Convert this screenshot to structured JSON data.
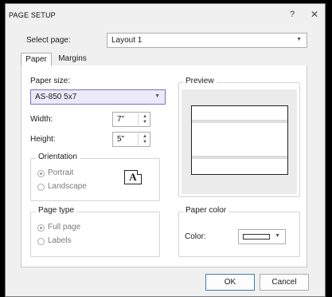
{
  "dialog": {
    "title": "PAGE SETUP",
    "help_label": "?",
    "close_label": "✕"
  },
  "select_page": {
    "label": "Select page:",
    "value": "Layout 1",
    "arrow": "▼"
  },
  "tabs": [
    {
      "label": "Paper",
      "active": true
    },
    {
      "label": "Margins",
      "active": false
    }
  ],
  "paper_size": {
    "label": "Paper size:",
    "value": "AS-850 5x7",
    "arrow": "▼"
  },
  "width": {
    "label": "Width:",
    "value": "7\"",
    "up": "▲",
    "down": "▼"
  },
  "height": {
    "label": "Height:",
    "value": "5\"",
    "up": "▲",
    "down": "▼"
  },
  "orientation": {
    "legend": "Orientation",
    "options": [
      {
        "label": "Portrait",
        "selected": true
      },
      {
        "label": "Landscape",
        "selected": false
      }
    ],
    "icon_letter": "A"
  },
  "preview": {
    "legend": "Preview"
  },
  "page_type": {
    "legend": "Page type",
    "options": [
      {
        "label": "Full page",
        "selected": true
      },
      {
        "label": "Labels",
        "selected": false
      }
    ]
  },
  "paper_color": {
    "legend": "Paper color",
    "label": "Color:",
    "swatch": "#ffffff",
    "arrow": "▼"
  },
  "buttons": {
    "ok": "OK",
    "cancel": "Cancel"
  },
  "colors": {
    "dialog_bg": "#f0f0f0",
    "panel_bg": "#ffffff",
    "selection_border": "#7b70c9",
    "primary_border": "#3c7fb1",
    "frame": "#000000"
  }
}
